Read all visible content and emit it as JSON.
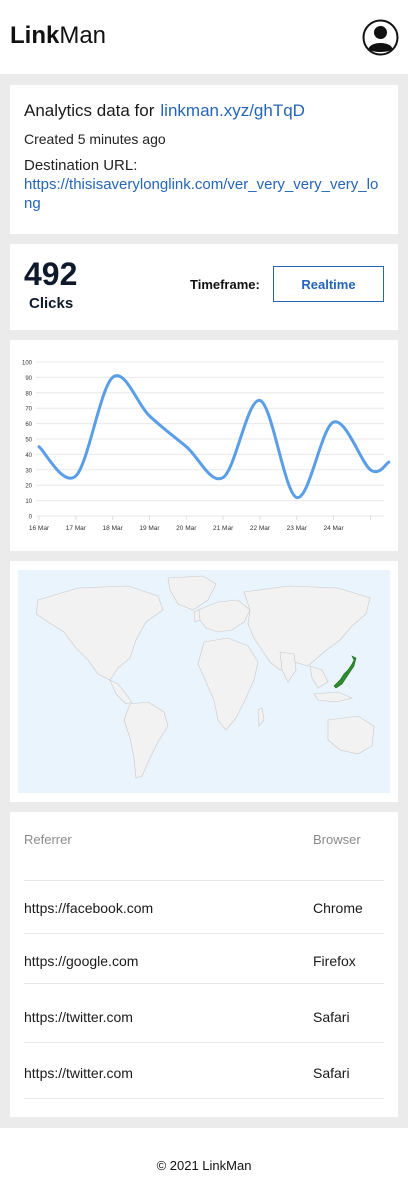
{
  "header": {
    "brand_bold": "Link",
    "brand_light": "Man",
    "avatar_icon": "user-circle-icon"
  },
  "summary": {
    "title_prefix": "Analytics data for",
    "short_link": "linkman.xyz/ghTqD",
    "created": "Created 5 minutes ago",
    "destination_label": "Destination URL:",
    "destination_url": "https://thisisaverylonglink.com/ver_very_very_very_long"
  },
  "clicks": {
    "count": "492",
    "label": "Clicks",
    "timeframe_label": "Timeframe:",
    "timeframe_value": "Realtime"
  },
  "chart_data": {
    "type": "line",
    "x": [
      "16 Mar",
      "17 Mar",
      "18 Mar",
      "19 Mar",
      "20 Mar",
      "21 Mar",
      "22 Mar",
      "23 Mar",
      "24 Mar",
      ""
    ],
    "y_ticks": [
      0,
      10,
      20,
      30,
      40,
      50,
      60,
      70,
      80,
      90,
      100
    ],
    "series": [
      {
        "values": [
          45,
          26,
          90,
          65,
          45,
          25,
          75,
          12,
          61,
          30,
          35
        ]
      }
    ],
    "points_x_index": [
      0,
      1,
      2,
      3,
      4,
      5,
      6,
      7,
      8,
      9,
      9.5
    ],
    "ylim": [
      0,
      100
    ],
    "grid": true,
    "line_color": "#5a9ee8"
  },
  "map": {
    "highlight_country": "Japan",
    "highlight_color": "#2e8b2e",
    "ocean_color": "#eaf4fc",
    "land_color": "#f2f2f2"
  },
  "table": {
    "headers": {
      "referrer": "Referrer",
      "browser": "Browser"
    },
    "rows": [
      {
        "referrer": "https://facebook.com",
        "browser": "Chrome"
      },
      {
        "referrer": "https://google.com",
        "browser": "Firefox"
      },
      {
        "referrer": "https://twitter.com",
        "browser": "Safari"
      },
      {
        "referrer": "https://twitter.com",
        "browser": "Safari"
      }
    ]
  },
  "footer": {
    "copyright": "© 2021 LinkMan"
  },
  "colors": {
    "accent": "#2565b8",
    "background": "#ebebeb"
  }
}
